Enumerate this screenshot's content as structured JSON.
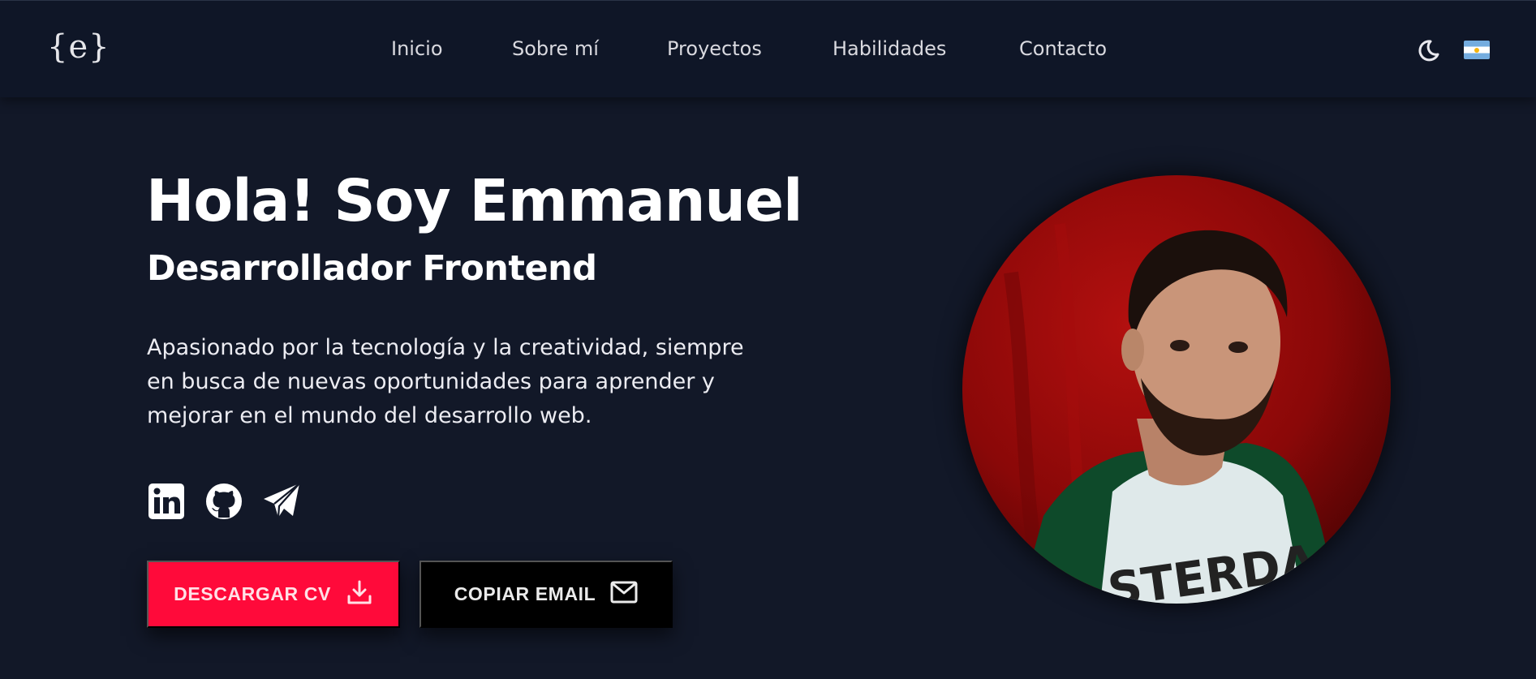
{
  "header": {
    "logo": "{e}",
    "nav": [
      {
        "label": "Inicio"
      },
      {
        "label": "Sobre mí"
      },
      {
        "label": "Proyectos"
      },
      {
        "label": "Habilidades"
      },
      {
        "label": "Contacto"
      }
    ],
    "theme_icon": "moon-icon",
    "language_flag": "argentina-flag-icon"
  },
  "hero": {
    "title": "Hola! Soy Emmanuel",
    "subtitle": "Desarrollador Frontend",
    "description": "Apasionado por la tecnología y la creatividad, siempre en busca de nuevas oportunidades para aprender y mejorar en el mundo del desarrollo web.",
    "socials": [
      {
        "icon": "linkedin-icon"
      },
      {
        "icon": "github-icon"
      },
      {
        "icon": "telegram-icon"
      }
    ],
    "buttons": {
      "cv_label": "DESCARGAR CV",
      "cv_icon": "download-icon",
      "email_label": "COPIAR EMAIL",
      "email_icon": "mail-icon"
    }
  },
  "colors": {
    "background": "#121828",
    "navbar": "#0f1627",
    "accent": "#ff0a3a",
    "button_dark": "#000000",
    "text": "#ffffff"
  }
}
